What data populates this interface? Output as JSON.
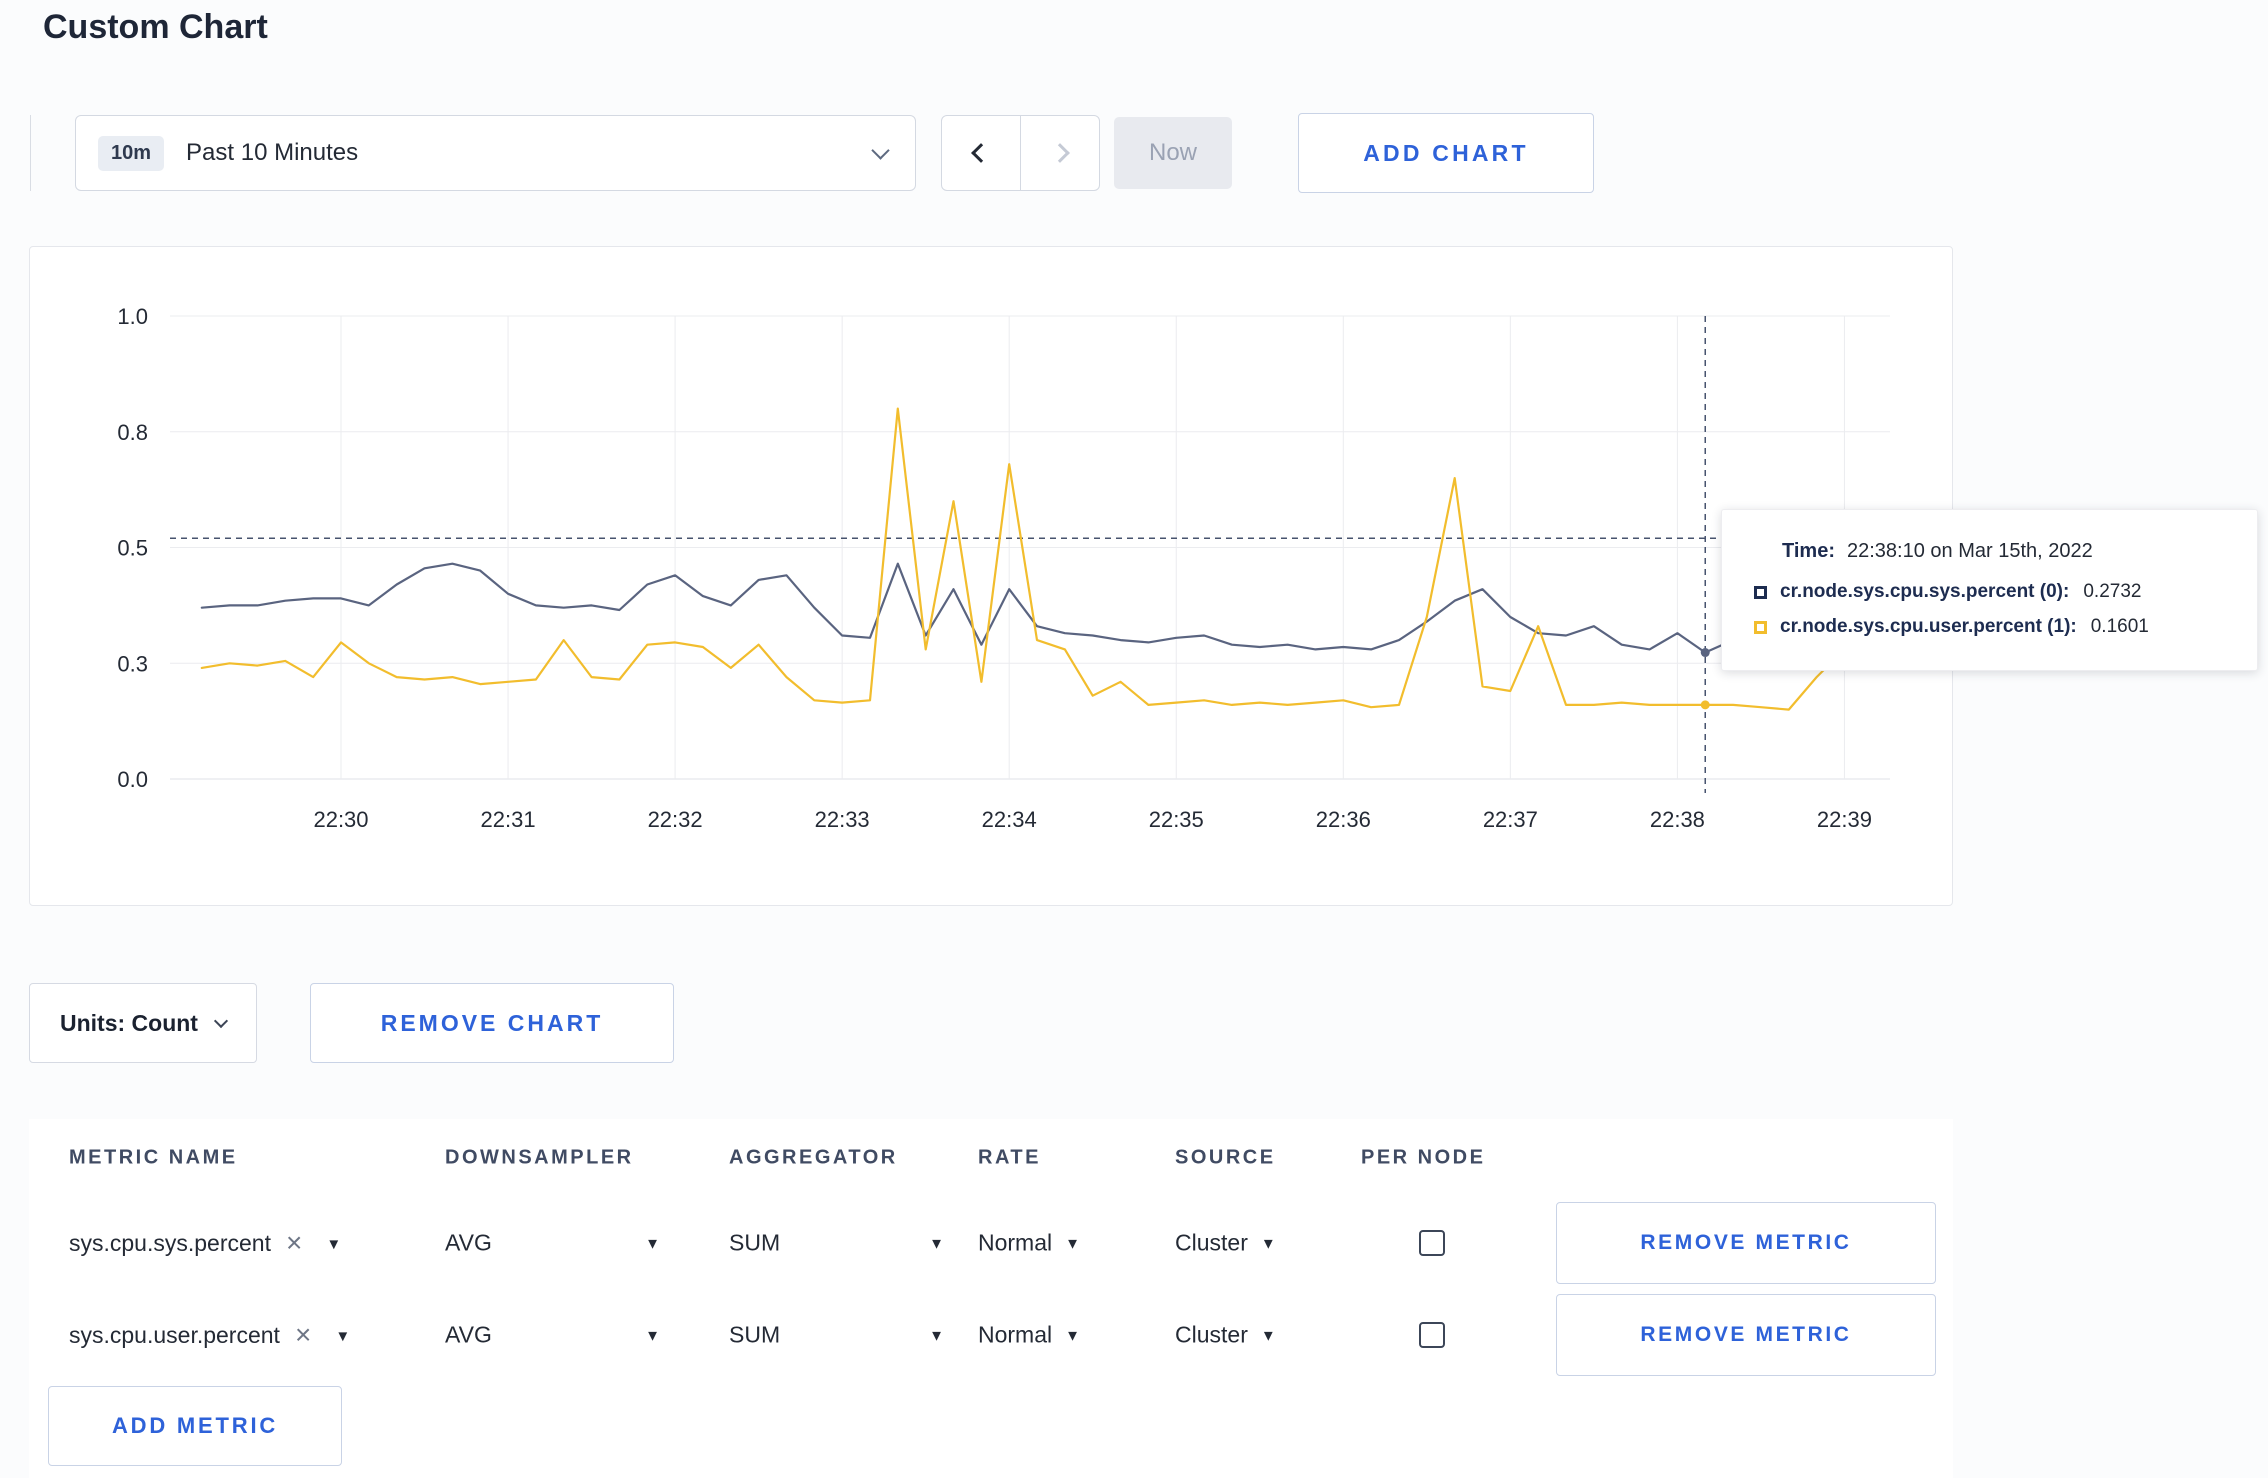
{
  "page": {
    "title": "Custom Chart"
  },
  "toolbar": {
    "time_badge": "10m",
    "time_label": "Past 10 Minutes",
    "now_label": "Now",
    "add_chart_label": "ADD CHART"
  },
  "chart_controls": {
    "units_label": "Units: Count",
    "remove_chart_label": "REMOVE CHART"
  },
  "tooltip": {
    "time_label": "Time:",
    "time_value": "22:38:10 on Mar 15th, 2022",
    "series": [
      {
        "name": "cr.node.sys.cpu.sys.percent (0):",
        "value": "0.2732",
        "color": "#1d2c50"
      },
      {
        "name": "cr.node.sys.cpu.user.percent (1):",
        "value": "0.1601",
        "color": "#f2bd2d"
      }
    ]
  },
  "icons": {
    "close_x": "×",
    "caret_down": "▼"
  },
  "metrics_table": {
    "headers": [
      "METRIC NAME",
      "DOWNSAMPLER",
      "AGGREGATOR",
      "RATE",
      "SOURCE",
      "PER NODE"
    ],
    "rows": [
      {
        "metric": "sys.cpu.sys.percent",
        "downsampler": "AVG",
        "aggregator": "SUM",
        "rate": "Normal",
        "source": "Cluster",
        "per_node": false,
        "remove_label": "REMOVE METRIC"
      },
      {
        "metric": "sys.cpu.user.percent",
        "downsampler": "AVG",
        "aggregator": "SUM",
        "rate": "Normal",
        "source": "Cluster",
        "per_node": false,
        "remove_label": "REMOVE METRIC"
      }
    ],
    "add_metric_label": "ADD METRIC"
  },
  "chart_data": {
    "type": "line",
    "title": "Custom Chart",
    "y_axis": {
      "range": [
        0,
        1.0
      ],
      "tick_values": [
        0,
        0.25,
        0.5,
        0.75,
        1.0
      ],
      "tick_labels": [
        "0.0",
        "0.3",
        "0.5",
        "0.8",
        "1.0"
      ]
    },
    "x_axis": {
      "tick_labels": [
        "22:30",
        "22:31",
        "22:32",
        "22:33",
        "22:34",
        "22:35",
        "22:36",
        "22:37",
        "22:38",
        "22:39"
      ],
      "tick_seconds": [
        30,
        90,
        150,
        210,
        270,
        330,
        390,
        450,
        510,
        570
      ]
    },
    "time_origin": "22:29:30",
    "first_sample_offset_seconds": -20,
    "sample_interval_seconds": 10,
    "grid": true,
    "legend": "tooltip",
    "series": [
      {
        "name": "cr.node.sys.cpu.sys.percent",
        "color": "#5a6480",
        "values": [
          0.37,
          0.375,
          0.375,
          0.385,
          0.39,
          0.39,
          0.375,
          0.42,
          0.455,
          0.465,
          0.45,
          0.4,
          0.375,
          0.37,
          0.375,
          0.365,
          0.42,
          0.44,
          0.395,
          0.375,
          0.43,
          0.44,
          0.37,
          0.31,
          0.305,
          0.465,
          0.31,
          0.41,
          0.29,
          0.41,
          0.33,
          0.315,
          0.31,
          0.3,
          0.295,
          0.305,
          0.31,
          0.29,
          0.285,
          0.29,
          0.28,
          0.285,
          0.28,
          0.3,
          0.34,
          0.385,
          0.41,
          0.35,
          0.315,
          0.31,
          0.33,
          0.29,
          0.28,
          0.315,
          0.2732,
          0.3,
          0.31,
          0.3,
          0.305,
          0.3
        ]
      },
      {
        "name": "cr.node.sys.cpu.user.percent",
        "color": "#f2bd2d",
        "values": [
          0.24,
          0.25,
          0.245,
          0.255,
          0.22,
          0.295,
          0.25,
          0.22,
          0.215,
          0.22,
          0.205,
          0.21,
          0.215,
          0.3,
          0.22,
          0.215,
          0.29,
          0.295,
          0.285,
          0.24,
          0.29,
          0.22,
          0.17,
          0.165,
          0.17,
          0.8,
          0.28,
          0.6,
          0.21,
          0.68,
          0.3,
          0.28,
          0.18,
          0.21,
          0.16,
          0.165,
          0.17,
          0.16,
          0.165,
          0.16,
          0.165,
          0.17,
          0.155,
          0.16,
          0.35,
          0.65,
          0.2,
          0.19,
          0.33,
          0.16,
          0.16,
          0.165,
          0.16,
          0.16,
          0.1601,
          0.16,
          0.155,
          0.15,
          0.22,
          0.28
        ]
      }
    ],
    "crosshair": {
      "time_offset_seconds": 520,
      "y_fraction": 0.52,
      "time_label": "22:38:10"
    },
    "hover_points": [
      {
        "series": 0,
        "value": 0.2732
      },
      {
        "series": 1,
        "value": 0.1601
      }
    ]
  }
}
